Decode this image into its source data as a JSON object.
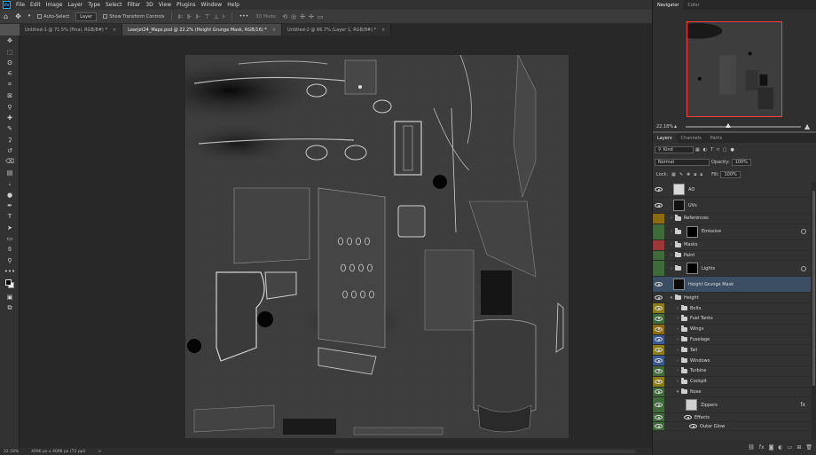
{
  "app": {
    "logo": "Ps"
  },
  "menu": [
    "File",
    "Edit",
    "Image",
    "Layer",
    "Type",
    "Select",
    "Filter",
    "3D",
    "View",
    "Plugins",
    "Window",
    "Help"
  ],
  "options": {
    "home_icon": "home-icon",
    "move_icon": "move-tool-icon",
    "auto_select_label": "Auto-Select",
    "auto_select_target": "Layer",
    "transform_label": "Show Transform Controls",
    "more_label": "•••",
    "mode_3d_label": "3D Mode:"
  },
  "tabs": [
    {
      "label": "Untitled-1 @ 71.5% (Final, RGB/8#) *",
      "active": false
    },
    {
      "label": "Learjet24_Maps.psd @ 22.2% (Height Grunge Mask, RGB/16) *",
      "active": true
    },
    {
      "label": "Untitled-2 @ 66.7% (Layer 1, RGB/8#) *",
      "active": false
    }
  ],
  "tab_close": "×",
  "tools": [
    "move-icon",
    "marquee-icon",
    "lasso-icon",
    "quick-select-icon",
    "crop-icon",
    "frame-icon",
    "eyedropper-icon",
    "healing-icon",
    "brush-icon",
    "stamp-icon",
    "history-brush-icon",
    "eraser-icon",
    "gradient-icon",
    "blur-icon",
    "dodge-icon",
    "pen-icon",
    "type-icon",
    "path-select-icon",
    "shape-icon",
    "hand-icon",
    "zoom-icon",
    "more-tools-icon"
  ],
  "status": {
    "zoom": "22.18%",
    "size": "4096 px x 4096 px (72 ppi)",
    "arrow": ">"
  },
  "navigator": {
    "tab_active": "Navigator",
    "tab_other": "Color",
    "zoom": "22.18%"
  },
  "layers_panel": {
    "tabs": [
      "Layers",
      "Channels",
      "Paths"
    ],
    "filter": "Kind",
    "blend_mode": "Normal",
    "opacity_label": "Opacity:",
    "opacity": "100%",
    "lock_label": "Lock:",
    "fill_label": "Fill:",
    "fill": "100%"
  },
  "colors": {
    "red": "#9b3737",
    "orange": "#8c6a12",
    "yellow": "#8b7d15",
    "green": "#3f6b3b",
    "blue": "#3a5a93",
    "violet": "#5b4b8c",
    "none": "transparent"
  },
  "layers": [
    {
      "name": "AO",
      "kind": "layer",
      "color": "none",
      "visible": true,
      "depth": 0,
      "thumb": "#d9d9d9"
    },
    {
      "name": "UVs",
      "kind": "layer",
      "color": "none",
      "visible": true,
      "depth": 0,
      "thumb": "#111"
    },
    {
      "name": "References",
      "kind": "folder",
      "color": "orange",
      "visible": false,
      "depth": 0
    },
    {
      "name": "Emissive",
      "kind": "folder-mask",
      "color": "green",
      "visible": false,
      "depth": 0,
      "thumb": "#000"
    },
    {
      "name": "Masks",
      "kind": "folder",
      "color": "red",
      "visible": false,
      "depth": 0
    },
    {
      "name": "Paint",
      "kind": "folder",
      "color": "green",
      "visible": false,
      "depth": 0
    },
    {
      "name": "Lights",
      "kind": "folder-mask",
      "color": "green",
      "visible": false,
      "depth": 0,
      "thumb": "#000"
    },
    {
      "name": "Height Grunge Mask",
      "kind": "layer",
      "color": "none",
      "visible": true,
      "depth": 0,
      "thumb": "#0a0a0a",
      "selected": true
    },
    {
      "name": "Height",
      "kind": "folder-open",
      "color": "none",
      "visible": true,
      "depth": 0
    },
    {
      "name": "Bolts",
      "kind": "folder",
      "color": "yellow",
      "visible": true,
      "depth": 1
    },
    {
      "name": "Fuel Tanks",
      "kind": "folder",
      "color": "green",
      "visible": true,
      "depth": 1
    },
    {
      "name": "Wings",
      "kind": "folder",
      "color": "orange",
      "visible": true,
      "depth": 1
    },
    {
      "name": "Fuselage",
      "kind": "folder",
      "color": "blue",
      "visible": true,
      "depth": 1
    },
    {
      "name": "Tail",
      "kind": "folder",
      "color": "yellow",
      "visible": true,
      "depth": 1
    },
    {
      "name": "Windows",
      "kind": "folder",
      "color": "blue",
      "visible": true,
      "depth": 1
    },
    {
      "name": "Turbine",
      "kind": "folder",
      "color": "green",
      "visible": true,
      "depth": 1
    },
    {
      "name": "Cockpit",
      "kind": "folder",
      "color": "yellow",
      "visible": true,
      "depth": 1
    },
    {
      "name": "Nose",
      "kind": "folder-open",
      "color": "green",
      "visible": true,
      "depth": 1
    },
    {
      "name": "Zippers",
      "kind": "layer-fx",
      "color": "green",
      "visible": true,
      "depth": 2,
      "thumb": "#cfcfcf"
    },
    {
      "name": "Effects",
      "kind": "effects",
      "color": "green",
      "visible": true,
      "depth": 2
    },
    {
      "name": "Outer Glow",
      "kind": "effect",
      "color": "green",
      "visible": true,
      "depth": 2
    }
  ],
  "footer_icons": [
    "link-icon",
    "fx-icon",
    "mask-icon",
    "adjustment-icon",
    "group-icon",
    "new-layer-icon",
    "trash-icon"
  ]
}
